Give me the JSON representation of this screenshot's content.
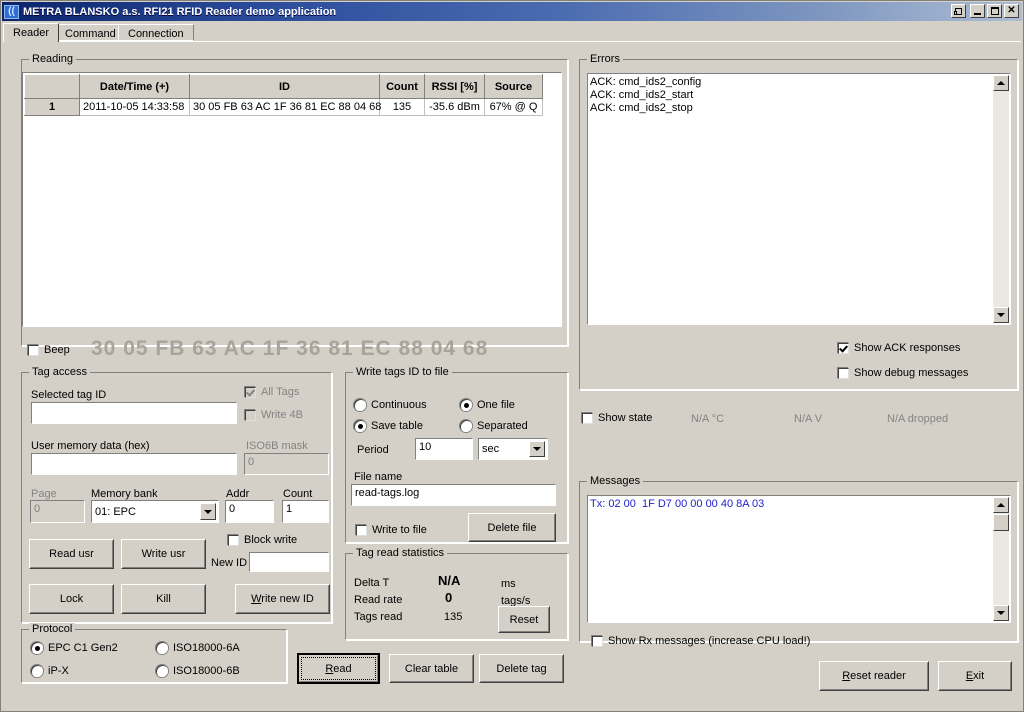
{
  "window": {
    "title": "METRA BLANSKO a.s. RFI21 RFID Reader demo application",
    "icon": "signal-waves-icon",
    "buttons": {
      "restore_label": "restore-window-icon",
      "minimize_label": "minimize-icon",
      "maximize_label": "maximize-icon",
      "close_label": "✕"
    }
  },
  "tabs": [
    {
      "label": "Reader",
      "selected": true
    },
    {
      "label": "Command",
      "selected": false
    },
    {
      "label": "Connection",
      "selected": false
    }
  ],
  "reading": {
    "caption": "Reading",
    "columns": [
      "",
      "Date/Time (+)",
      "ID",
      "Count",
      "RSSI [%]",
      "Source"
    ],
    "rows": [
      {
        "index": "1",
        "datetime": "2011-10-05 14:33:58",
        "id": "30 05 FB 63 AC 1F 36 81 EC 88 04 68",
        "count": "135",
        "rssi": "-35.6 dBm",
        "source": "67% @ Q"
      }
    ],
    "beep_label": "Beep",
    "beep_checked": false,
    "big_tag_id": "30 05 FB 63 AC 1F 36 81 EC 88 04 68"
  },
  "tag_access": {
    "caption": "Tag access",
    "selected_tag_id_label": "Selected tag ID",
    "selected_tag_id_value": "",
    "user_memory_label": "User memory data (hex)",
    "user_memory_value": "",
    "all_tags_label": "All Tags",
    "all_tags_checked": true,
    "write_4b_label": "Write 4B",
    "write_4b_checked": false,
    "iso6b_mask_label": "ISO6B mask",
    "iso6b_mask_value": "0",
    "page_label": "Page",
    "page_value": "0",
    "memory_bank_label": "Memory bank",
    "memory_bank_value": "01: EPC",
    "addr_label": "Addr",
    "addr_value": "0",
    "count_label": "Count",
    "count_value": "1",
    "read_usr_label": "Read usr",
    "write_usr_label": "Write usr",
    "lock_label": "Lock",
    "kill_label": "Kill",
    "block_write_label": "Block write",
    "block_write_checked": false,
    "new_id_label": "New ID",
    "new_id_value": "",
    "write_new_id_label": "Write new ID",
    "write_new_id_accel": "W"
  },
  "write_file": {
    "caption": "Write tags ID to file",
    "continuous_label": "Continuous",
    "save_table_label": "Save table",
    "mode_selected": "Save table",
    "one_file_label": "One file",
    "separated_label": "Separated",
    "file_mode_selected": "One file",
    "period_label": "Period",
    "period_value": "10",
    "period_unit": "sec",
    "file_name_label": "File name",
    "file_name_value": "read-tags.log",
    "write_to_file_label": "Write to file",
    "write_to_file_checked": false,
    "delete_file_label": "Delete file"
  },
  "statistics": {
    "caption": "Tag read statistics",
    "delta_t_label": "Delta T",
    "delta_t_value": "N/A",
    "delta_t_unit": "ms",
    "read_rate_label": "Read rate",
    "read_rate_value": "0",
    "read_rate_unit": "tags/s",
    "tags_read_label": "Tags read",
    "tags_read_value": "135",
    "reset_label": "Reset"
  },
  "protocol": {
    "caption": "Protocol",
    "options": [
      "EPC C1 Gen2",
      "iP-X",
      "ISO18000-6A",
      "ISO18000-6B"
    ],
    "selected": "EPC C1 Gen2"
  },
  "actions": {
    "read_label": "Read",
    "read_accel": "R",
    "clear_table_label": "Clear table",
    "delete_tag_label": "Delete tag"
  },
  "errors": {
    "caption": "Errors",
    "lines": "ACK: cmd_ids2_config\nACK: cmd_ids2_start\nACK: cmd_ids2_stop",
    "show_ack_label": "Show ACK responses",
    "show_ack_checked": true,
    "show_debug_label": "Show debug messages",
    "show_debug_checked": false
  },
  "state": {
    "show_state_label": "Show state",
    "show_state_checked": false,
    "temperature": "N/A °C",
    "voltage": "N/A V",
    "dropped": "N/A dropped"
  },
  "messages": {
    "caption": "Messages",
    "lines": "Tx: 02 00  1F D7 00 00 00 40 8A 03",
    "show_rx_label": "Show Rx messages (increase CPU load!)",
    "show_rx_checked": false,
    "text_color": "#2222cc"
  },
  "footer": {
    "reset_reader_label": "Reset reader",
    "reset_reader_accel": "R",
    "exit_label": "Exit",
    "exit_accel": "E"
  }
}
